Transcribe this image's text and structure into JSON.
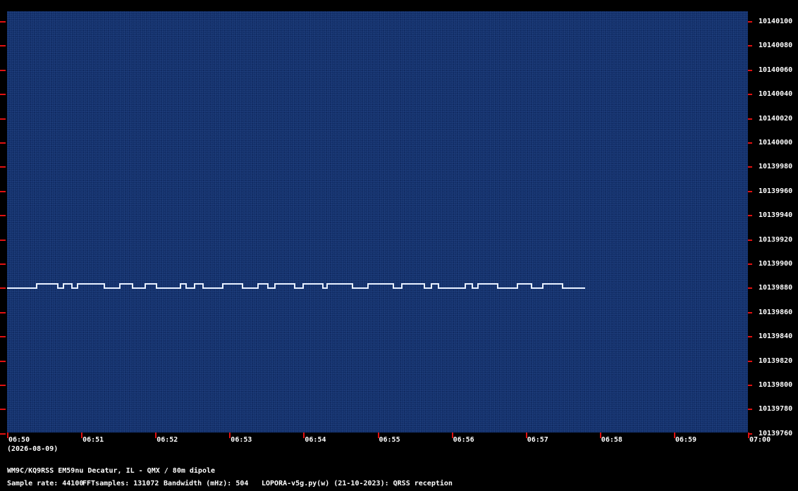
{
  "colors": {
    "waterfall": "#13306a",
    "trace": "#e8f0ff",
    "tick": "#e01010"
  },
  "freq_labels": [
    "10140100",
    "10140080",
    "10140060",
    "10140040",
    "10140020",
    "10140000",
    "10139980",
    "10139960",
    "10139940",
    "10139920",
    "10139900",
    "10139880",
    "10139860",
    "10139840",
    "10139820",
    "10139800",
    "10139780",
    "10139760"
  ],
  "time_labels": [
    "06:50",
    "06:51",
    "06:52",
    "06:53",
    "06:54",
    "06:55",
    "06:56",
    "06:57",
    "06:58",
    "06:59",
    "07:00"
  ],
  "date_label": "(2026-08-09)",
  "footer": {
    "station": "WM9C/KQ9RSS EM59nu Decatur, IL - QMX / 80m dipole",
    "sample_rate": "Sample rate: 44100",
    "fft_samples": "FFTsamples: 131072",
    "bandwidth": "Bandwidth (mHz): 504",
    "program": "LOPORA-v5g.py(w) (21-10-2023): QRSS reception"
  }
}
